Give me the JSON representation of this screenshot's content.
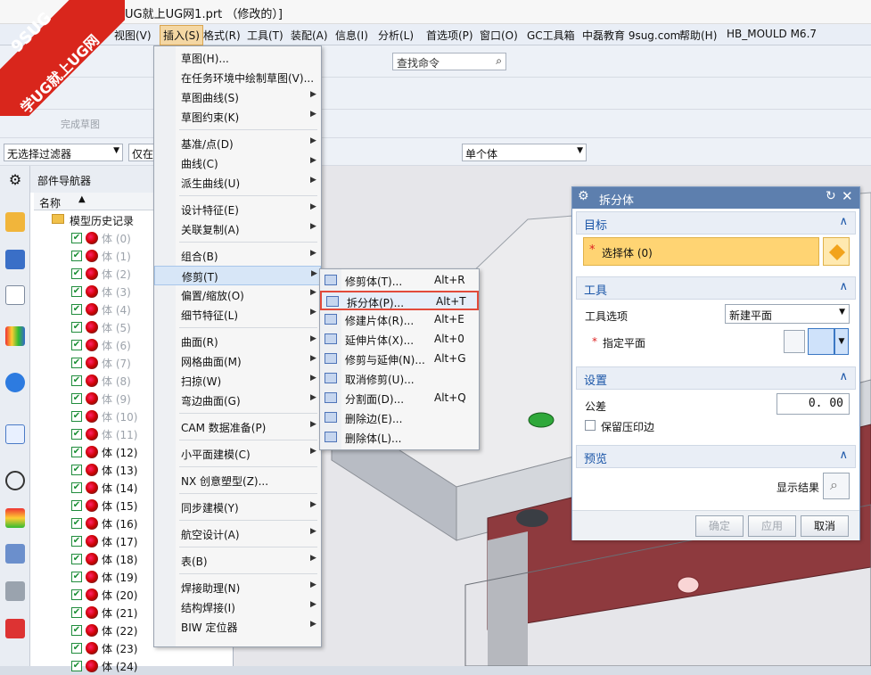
{
  "title": {
    "text": "UG就上UG网1.prt （修改的）]"
  },
  "menubar": [
    "视图(V)",
    "插入(S)",
    "格式(R)",
    "工具(T)",
    "装配(A)",
    "信息(I)",
    "分析(L)",
    "首选项(P)",
    "窗口(O)",
    "GC工具箱",
    "中磊教育 9sug.com",
    "帮助(H)",
    "HB_MOULD M6.7"
  ],
  "watermark": {
    "line1": "9SUG",
    "line2": "学UG就上UG网"
  },
  "toolbar": {
    "search_placeholder": "查找命令",
    "finish_sketch": "完成草图",
    "filter": "无选择过滤器",
    "scope": "仅在",
    "body_select": "单个体"
  },
  "part_nav": {
    "title": "部件导航器",
    "col_name": "名称",
    "root": "模型历史记录",
    "items": [
      {
        "label": "体 (0)",
        "dim": true
      },
      {
        "label": "体 (1)",
        "dim": true
      },
      {
        "label": "体 (2)",
        "dim": true
      },
      {
        "label": "体 (3)",
        "dim": true
      },
      {
        "label": "体 (4)",
        "dim": true
      },
      {
        "label": "体 (5)",
        "dim": true
      },
      {
        "label": "体 (6)",
        "dim": true
      },
      {
        "label": "体 (7)",
        "dim": true
      },
      {
        "label": "体 (8)",
        "dim": true
      },
      {
        "label": "体 (9)",
        "dim": true
      },
      {
        "label": "体 (10)",
        "dim": true
      },
      {
        "label": "体 (11)",
        "dim": true
      },
      {
        "label": "体 (12)",
        "dim": false
      },
      {
        "label": "体 (13)",
        "dim": false
      },
      {
        "label": "体 (14)",
        "dim": false
      },
      {
        "label": "体 (15)",
        "dim": false
      },
      {
        "label": "体 (16)",
        "dim": false
      },
      {
        "label": "体 (17)",
        "dim": false
      },
      {
        "label": "体 (18)",
        "dim": false
      },
      {
        "label": "体 (19)",
        "dim": false
      },
      {
        "label": "体 (20)",
        "dim": false
      },
      {
        "label": "体 (21)",
        "dim": false
      },
      {
        "label": "体 (22)",
        "dim": false
      },
      {
        "label": "体 (23)",
        "dim": false
      },
      {
        "label": "体 (24)",
        "dim": false
      }
    ]
  },
  "insert_menu": [
    {
      "label": "草图(H)..."
    },
    {
      "label": "在任务环境中绘制草图(V)..."
    },
    {
      "label": "草图曲线(S)",
      "sub": true
    },
    {
      "label": "草图约束(K)",
      "sub": true
    },
    {
      "sep": true
    },
    {
      "label": "基准/点(D)",
      "sub": true
    },
    {
      "label": "曲线(C)",
      "sub": true
    },
    {
      "label": "派生曲线(U)",
      "sub": true
    },
    {
      "sep": true
    },
    {
      "label": "设计特征(E)",
      "sub": true
    },
    {
      "label": "关联复制(A)",
      "sub": true
    },
    {
      "sep": true
    },
    {
      "label": "组合(B)",
      "sub": true
    },
    {
      "label": "修剪(T)",
      "sub": true,
      "hl": true
    },
    {
      "label": "偏置/缩放(O)",
      "sub": true
    },
    {
      "label": "细节特征(L)",
      "sub": true
    },
    {
      "sep": true
    },
    {
      "label": "曲面(R)",
      "sub": true
    },
    {
      "label": "网格曲面(M)",
      "sub": true
    },
    {
      "label": "扫掠(W)",
      "sub": true
    },
    {
      "label": "弯边曲面(G)",
      "sub": true
    },
    {
      "sep": true
    },
    {
      "label": "CAM 数据准备(P)",
      "sub": true
    },
    {
      "sep": true
    },
    {
      "label": "小平面建模(C)",
      "sub": true
    },
    {
      "sep": true
    },
    {
      "label": "NX 创意塑型(Z)..."
    },
    {
      "sep": true
    },
    {
      "label": "同步建模(Y)",
      "sub": true
    },
    {
      "sep": true
    },
    {
      "label": "航空设计(A)",
      "sub": true
    },
    {
      "sep": true
    },
    {
      "label": "表(B)",
      "sub": true
    },
    {
      "sep": true
    },
    {
      "label": "焊接助理(N)",
      "sub": true
    },
    {
      "label": "结构焊接(I)",
      "sub": true
    },
    {
      "label": "BIW 定位器",
      "sub": true
    }
  ],
  "trim_menu": [
    {
      "label": "修剪体(T)...",
      "key": "Alt+R"
    },
    {
      "label": "拆分体(P)...",
      "key": "Alt+T",
      "boxed": true
    },
    {
      "label": "修建片体(R)...",
      "key": "Alt+E"
    },
    {
      "label": "延伸片体(X)...",
      "key": "Alt+0"
    },
    {
      "label": "修剪与延伸(N)...",
      "key": "Alt+G"
    },
    {
      "label": "取消修剪(U)...",
      "key": ""
    },
    {
      "label": "分割面(D)...",
      "key": "Alt+Q"
    },
    {
      "label": "删除边(E)...",
      "key": ""
    },
    {
      "label": "删除体(L)...",
      "key": ""
    }
  ],
  "dialog": {
    "title": "拆分体",
    "target_section": "目标",
    "select_body": "选择体 (0)",
    "tool_section": "工具",
    "tool_option_label": "工具选项",
    "tool_option_value": "新建平面",
    "specify_plane": "指定平面",
    "settings_section": "设置",
    "tolerance_label": "公差",
    "tolerance_value": "0. 00",
    "keep_imprint": "保留压印边",
    "preview_section": "预览",
    "show_result": "显示结果",
    "ok": "确定",
    "apply": "应用",
    "cancel": "取消"
  },
  "colors": {
    "highlight_box": "#e24b3b",
    "dialog_title": "#5d7fae",
    "select_row": "#ffd473"
  }
}
